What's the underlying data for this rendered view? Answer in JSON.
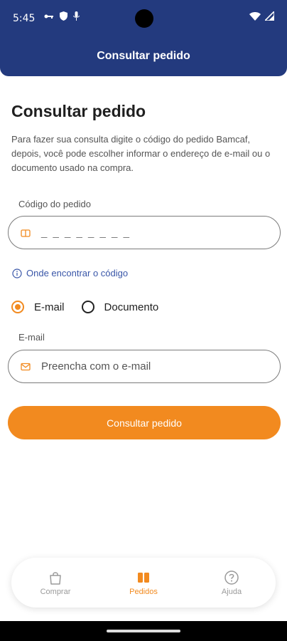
{
  "status": {
    "time": "5:45"
  },
  "header": {
    "title": "Consultar pedido"
  },
  "page": {
    "title": "Consultar pedido",
    "description": "Para fazer sua consulta digite o código do pedido Bamcaf, depois, você pode escolher informar o endereço de e-mail ou o documento usado na compra."
  },
  "order_code": {
    "label": "Código do pedido",
    "value": "_ _ _ _ _ _ _ _"
  },
  "help_link": {
    "label": "Onde encontrar o código"
  },
  "radio": {
    "email_label": "E-mail",
    "document_label": "Documento",
    "selected": "email"
  },
  "email": {
    "label": "E-mail",
    "placeholder": "Preencha com o e-mail"
  },
  "submit": {
    "label": "Consultar pedido"
  },
  "nav": {
    "items": [
      {
        "label": "Comprar",
        "icon": "bag-icon",
        "active": false
      },
      {
        "label": "Pedidos",
        "icon": "orders-icon",
        "active": true
      },
      {
        "label": "Ajuda",
        "icon": "help-icon",
        "active": false
      }
    ]
  },
  "colors": {
    "header": "#233a7e",
    "accent": "#f28a1f",
    "link": "#3956a8"
  }
}
